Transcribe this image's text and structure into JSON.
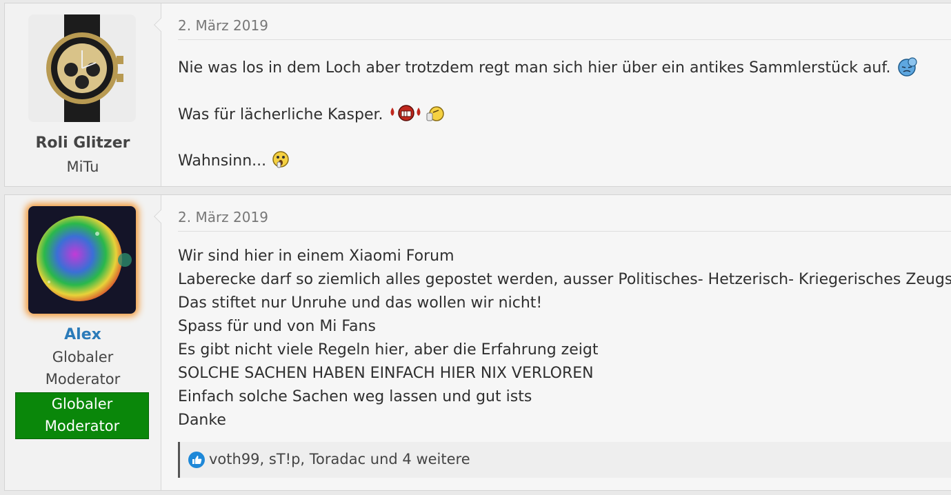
{
  "posts": [
    {
      "author": "Roli Glitzer",
      "user_title": "MiTu",
      "date": "2. März 2019",
      "lines": [
        "Nie was los in dem Loch aber trotzdem regt man sich hier über ein antikes Sammlerstück auf.",
        "Was für lächerliche Kasper.",
        "Wahnsinn..."
      ],
      "author_color": "#444444"
    },
    {
      "author": "Alex",
      "user_title_line1": "Globaler",
      "user_title_line2": "Moderator",
      "banner_line1": "Globaler",
      "banner_line2": "Moderator",
      "date": "2. März 2019",
      "lines": [
        "Wir sind hier in einem Xiaomi Forum",
        "Laberecke darf so ziemlich alles gepostet werden, ausser Politisches- Hetzerisch- Kriegerisches Zeugs",
        "Das stiftet nur Unruhe und das wollen wir nicht!",
        "Spass für und von Mi Fans",
        "Es gibt nicht viele Regeln hier, aber die Erfahrung zeigt",
        "SOLCHE SACHEN HABEN EINFACH HIER NIX VERLOREN",
        "Einfach solche Sachen weg lassen und gut ists",
        "Danke"
      ],
      "reactions": "voth99, sT!p, Toradac und 4 weitere",
      "author_color": "#2b7bb9",
      "banner_color": "#0a870a"
    }
  ]
}
